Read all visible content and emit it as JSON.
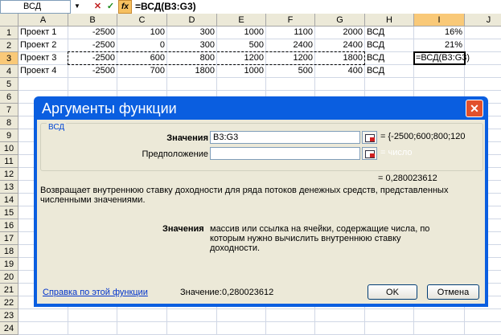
{
  "formula_bar": {
    "name_box": "ВСД",
    "cancel_icon": "✕",
    "enter_icon": "✓",
    "fx_icon": "fx",
    "formula": "=ВСД(B3:G3)"
  },
  "sheet": {
    "columns": [
      "A",
      "B",
      "C",
      "D",
      "E",
      "F",
      "G",
      "H",
      "I",
      "J"
    ],
    "rows": [
      "1",
      "2",
      "3",
      "4",
      "5",
      "6",
      "7",
      "8",
      "9",
      "10",
      "11",
      "12",
      "13",
      "14",
      "15",
      "16",
      "17",
      "18",
      "19",
      "20",
      "21",
      "22",
      "23",
      "24"
    ],
    "data": [
      [
        "Проект 1",
        "-2500",
        "100",
        "300",
        "1000",
        "1100",
        "2000",
        "ВСД",
        "16%"
      ],
      [
        "Проект 2",
        "-2500",
        "0",
        "300",
        "500",
        "2400",
        "2400",
        "ВСД",
        "21%"
      ],
      [
        "Проект 3",
        "-2500",
        "600",
        "800",
        "1200",
        "1200",
        "1800",
        "ВСД",
        "=ВСД(B3:G3)"
      ],
      [
        "Проект 4",
        "-2500",
        "700",
        "1800",
        "1000",
        "500",
        "400",
        "ВСД",
        ""
      ]
    ]
  },
  "dialog": {
    "title": "Аргументы функции",
    "group_label": "ВСД",
    "arg1_label": "Значения",
    "arg1_value": "B3:G3",
    "arg1_result": "= {-2500;600;800;120",
    "arg2_label": "Предположение",
    "arg2_value": "",
    "arg2_result": "= число",
    "func_result": "= 0,280023612",
    "description": "Возвращает внутреннюю ставку доходности для ряда потоков денежных средств, представленных численными значениями.",
    "param_name": "Значения",
    "param_desc": "массив или ссылка на ячейки, содержащие числа, по которым нужно вычислить внутреннюю ставку доходности.",
    "help_link": "Справка по этой функции",
    "value_label": "Значение:",
    "value": "0,280023612",
    "ok": "OK",
    "cancel": "Отмена",
    "close_icon": "✕"
  }
}
